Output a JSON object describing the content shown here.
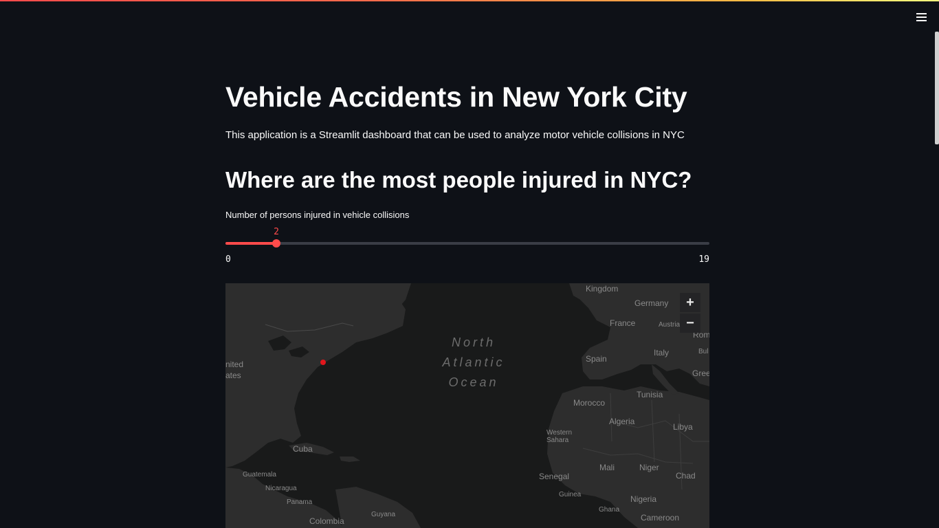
{
  "app": {
    "title": "Vehicle Accidents in New York City",
    "description": "This application is a Streamlit dashboard that can be used to analyze motor vehicle collisions in NYC",
    "subheader": "Where are the most people injured in NYC?"
  },
  "slider": {
    "label": "Number of persons injured in vehicle collisions",
    "value": "2",
    "min": "0",
    "max": "19",
    "fraction": 0.105,
    "accent": "#ff4b4b"
  },
  "menu": {
    "icon": "hamburger-menu-icon"
  },
  "map": {
    "zoom_in": "+",
    "zoom_out": "−",
    "ocean_label": [
      "North",
      "Atlantic",
      "Ocean"
    ],
    "labels": {
      "kingdom": "Kingdom",
      "germany": "Germany",
      "france": "France",
      "austria": "Austria",
      "romania": "Rom",
      "bulgaria": "Bul",
      "italy": "Italy",
      "spain": "Spain",
      "greece": "Gree",
      "tunisia": "Tunisia",
      "morocco": "Morocco",
      "algeria": "Algeria",
      "libya": "Libya",
      "western_sahara": [
        "Western",
        "Sahara"
      ],
      "mali": "Mali",
      "niger": "Niger",
      "chad": "Chad",
      "senegal": "Senegal",
      "guinea": "Guinea",
      "ghana": "Ghana",
      "nigeria": "Nigeria",
      "cameroon": "Cameroon",
      "united_states": [
        "nited",
        "ates"
      ],
      "cuba": "Cuba",
      "guatemala": "Guatemala",
      "nicaragua": "Nicaragua",
      "panama": "Panama",
      "guyana": "Guyana",
      "colombia": "Colombia"
    },
    "marker_color": "#e0161c"
  }
}
